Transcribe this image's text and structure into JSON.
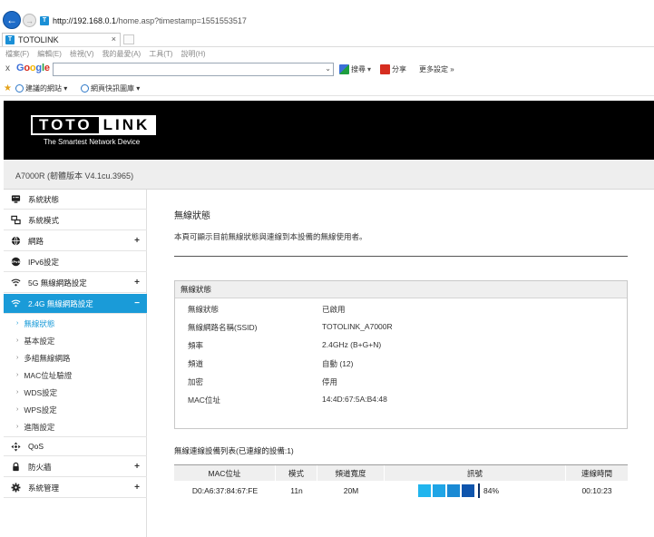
{
  "browser": {
    "url_host": "http://192.168.0.1",
    "url_path": "/home.asp?timestamp=1551553517",
    "tab_title": "TOTOLINK",
    "tab_close": "×",
    "menu": [
      "檔案(F)",
      "編輯(E)",
      "檢視(V)",
      "我的最愛(A)",
      "工具(T)",
      "說明(H)"
    ],
    "google_close": "x",
    "google_logo": "Google",
    "search_label": "搜尋",
    "share_label": "分享",
    "more_settings": "更多設定 »",
    "favorites": [
      "建議的網站 ▾",
      "網頁快訊圖庫 ▾"
    ]
  },
  "router": {
    "logo_left": "TOTO",
    "logo_right": "LINK",
    "tagline": "The Smartest Network Device",
    "model": "A7000R (韌體版本 V4.1cu.3965)"
  },
  "sidebar": {
    "items": [
      {
        "label": "系統狀態",
        "icon": "monitor-icon",
        "plus": ""
      },
      {
        "label": "系統模式",
        "icon": "network-mode-icon",
        "plus": ""
      },
      {
        "label": "網路",
        "icon": "globe-icon",
        "plus": "+"
      },
      {
        "label": "IPv6設定",
        "icon": "ipv6-icon",
        "plus": ""
      },
      {
        "label": "5G 無線網路設定",
        "icon": "wifi-icon",
        "plus": "+"
      },
      {
        "label": "2.4G 無線網路設定",
        "icon": "wifi-icon",
        "plus": "−"
      }
    ],
    "sub_items": [
      "無線狀態",
      "基本設定",
      "多組無線網路",
      "MAC位址驗證",
      "WDS設定",
      "WPS設定",
      "進階設定"
    ],
    "items_bottom": [
      {
        "label": "QoS",
        "icon": "qos-icon",
        "plus": ""
      },
      {
        "label": "防火牆",
        "icon": "lock-icon",
        "plus": "+"
      },
      {
        "label": "系統管理",
        "icon": "gear-icon",
        "plus": "+"
      }
    ]
  },
  "content": {
    "title": "無線狀態",
    "description": "本頁可顯示目前無線狀態與連線到本設備的無線使用者。",
    "status_header": "無線狀態",
    "status_rows": [
      {
        "label": "無線狀態",
        "value": "已啟用"
      },
      {
        "label": "無線網路名稱(SSID)",
        "value": "TOTOLINK_A7000R"
      },
      {
        "label": "頻率",
        "value": "2.4GHz (B+G+N)"
      },
      {
        "label": "頻道",
        "value": "自動 (12)"
      },
      {
        "label": "加密",
        "value": "停用"
      },
      {
        "label": "MAC位址",
        "value": "14:4D:67:5A:B4:48"
      }
    ],
    "client_title": "無線連線設備列表(已連線的設備:1)",
    "client_headers": [
      "MAC位址",
      "模式",
      "頻道寬度",
      "訊號",
      "連線時間"
    ],
    "client_rows": [
      {
        "mac": "D0:A6:37:84:67:FE",
        "mode": "11n",
        "width": "20M",
        "signal_percent": 84,
        "signal_text": "84%",
        "time": "00:10:23"
      }
    ]
  },
  "colors": {
    "accent": "#1a9bd8",
    "signal_light": "#21b5ee",
    "signal_mid": "#1a8ad4",
    "signal_dark": "#0f55ad"
  }
}
